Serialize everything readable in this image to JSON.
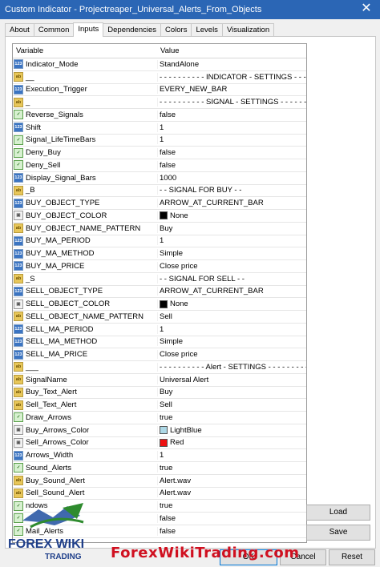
{
  "window": {
    "title": "Custom Indicator - Projectreaper_Universal_Alerts_From_Objects",
    "close_glyph": "✕"
  },
  "tabs": [
    "About",
    "Common",
    "Inputs",
    "Dependencies",
    "Colors",
    "Levels",
    "Visualization"
  ],
  "active_tab": 2,
  "grid": {
    "headers": {
      "variable": "Variable",
      "value": "Value"
    },
    "rows": [
      {
        "type": "num",
        "name": "Indicator_Mode",
        "value": "StandAlone"
      },
      {
        "type": "str",
        "name": "__",
        "value": "- - - - - - - - - - INDICATOR - SETTINGS - - - - -..."
      },
      {
        "type": "num",
        "name": "Execution_Trigger",
        "value": "EVERY_NEW_BAR"
      },
      {
        "type": "str",
        "name": "_",
        "value": "- - - - - - - - - - SIGNAL - SETTINGS - - - - - - - -"
      },
      {
        "type": "bool",
        "name": "Reverse_Signals",
        "value": "false"
      },
      {
        "type": "num",
        "name": "Shift",
        "value": "1"
      },
      {
        "type": "bool",
        "name": "Signal_LifeTimeBars",
        "value": "1"
      },
      {
        "type": "bool",
        "name": "Deny_Buy",
        "value": "false"
      },
      {
        "type": "bool",
        "name": "Deny_Sell",
        "value": "false"
      },
      {
        "type": "num",
        "name": "Display_Signal_Bars",
        "value": "1000"
      },
      {
        "type": "str",
        "name": "_B",
        "value": "- -  SIGNAL FOR BUY - -"
      },
      {
        "type": "num",
        "name": "BUY_OBJECT_TYPE",
        "value": "ARROW_AT_CURRENT_BAR"
      },
      {
        "type": "col",
        "name": "BUY_OBJECT_COLOR",
        "value": "None",
        "swatch": "#000000"
      },
      {
        "type": "str",
        "name": "BUY_OBJECT_NAME_PATTERN",
        "value": "Buy"
      },
      {
        "type": "num",
        "name": "BUY_MA_PERIOD",
        "value": "1"
      },
      {
        "type": "num",
        "name": "BUY_MA_METHOD",
        "value": "Simple"
      },
      {
        "type": "num",
        "name": "BUY_MA_PRICE",
        "value": "Close price"
      },
      {
        "type": "str",
        "name": "_S",
        "value": "- -  SIGNAL FOR SELL - -"
      },
      {
        "type": "num",
        "name": "SELL_OBJECT_TYPE",
        "value": "ARROW_AT_CURRENT_BAR"
      },
      {
        "type": "col",
        "name": "SELL_OBJECT_COLOR",
        "value": "None",
        "swatch": "#000000"
      },
      {
        "type": "str",
        "name": "SELL_OBJECT_NAME_PATTERN",
        "value": "Sell"
      },
      {
        "type": "num",
        "name": "SELL_MA_PERIOD",
        "value": "1"
      },
      {
        "type": "num",
        "name": "SELL_MA_METHOD",
        "value": "Simple"
      },
      {
        "type": "num",
        "name": "SELL_MA_PRICE",
        "value": "Close price"
      },
      {
        "type": "str",
        "name": "___",
        "value": "- - - - - - - - - - Alert - SETTINGS - - - - - - - - - -"
      },
      {
        "type": "str",
        "name": "SignalName",
        "value": "Universal Alert"
      },
      {
        "type": "str",
        "name": "Buy_Text_Alert",
        "value": "Buy"
      },
      {
        "type": "str",
        "name": "Sell_Text_Alert",
        "value": "Sell"
      },
      {
        "type": "bool",
        "name": "Draw_Arrows",
        "value": "true"
      },
      {
        "type": "col",
        "name": "Buy_Arrows_Color",
        "value": "LightBlue",
        "swatch": "#add8e6"
      },
      {
        "type": "col",
        "name": "Sell_Arrows_Color",
        "value": "Red",
        "swatch": "#ee1111"
      },
      {
        "type": "num",
        "name": "Arrows_Width",
        "value": "1"
      },
      {
        "type": "bool",
        "name": "Sound_Alerts",
        "value": "true"
      },
      {
        "type": "str",
        "name": "Buy_Sound_Alert",
        "value": "Alert.wav"
      },
      {
        "type": "str",
        "name": "Sell_Sound_Alert",
        "value": "Alert.wav"
      },
      {
        "type": "bool",
        "name": "ndows",
        "value": "true"
      },
      {
        "type": "bool",
        "name": "",
        "value": "false"
      },
      {
        "type": "bool",
        "name": "Mail_Alerts",
        "value": "false"
      }
    ]
  },
  "buttons": {
    "load": "Load",
    "save": "Save",
    "ok": "OK",
    "cancel": "Cancel",
    "reset": "Reset"
  },
  "icons": {
    "num": "123",
    "str": "ab",
    "bool": "✓",
    "col": "▣"
  },
  "branding": {
    "logo_line1": "FOREX WIKI",
    "logo_line2": "TRADING",
    "watermark": "ForexWikiTrading.com"
  }
}
